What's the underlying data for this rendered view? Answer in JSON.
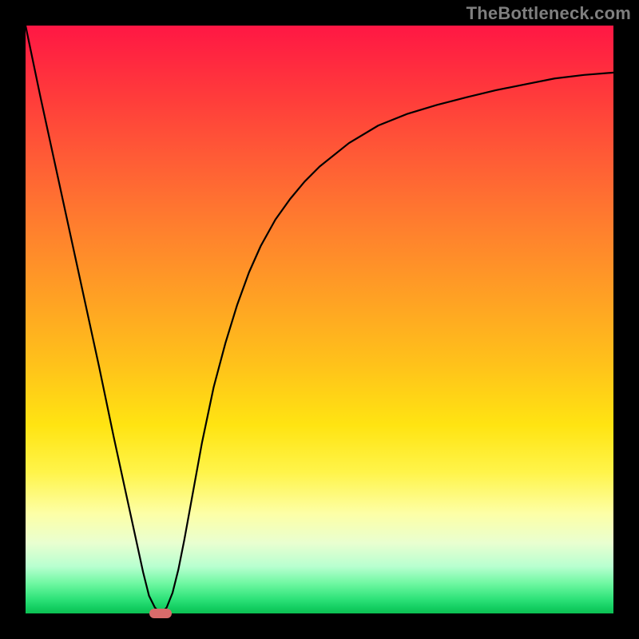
{
  "watermark": "TheBottleneck.com",
  "colors": {
    "frame": "#000000",
    "gradient_top": "#ff1744",
    "gradient_bottom": "#0dbf53",
    "curve": "#000000",
    "marker": "#d86b6b",
    "watermark_text": "#7f7f7f"
  },
  "chart_data": {
    "type": "line",
    "title": "",
    "xlabel": "",
    "ylabel": "",
    "xlim": [
      0,
      1
    ],
    "ylim": [
      0,
      1
    ],
    "x": [
      0.0,
      0.025,
      0.05,
      0.075,
      0.1,
      0.125,
      0.15,
      0.175,
      0.2,
      0.21,
      0.22,
      0.23,
      0.24,
      0.25,
      0.26,
      0.27,
      0.28,
      0.29,
      0.3,
      0.32,
      0.34,
      0.36,
      0.38,
      0.4,
      0.425,
      0.45,
      0.475,
      0.5,
      0.55,
      0.6,
      0.65,
      0.7,
      0.75,
      0.8,
      0.85,
      0.9,
      0.95,
      1.0
    ],
    "values": [
      1.0,
      0.88,
      0.765,
      0.65,
      0.535,
      0.42,
      0.3,
      0.185,
      0.07,
      0.03,
      0.01,
      0.0,
      0.01,
      0.035,
      0.075,
      0.125,
      0.18,
      0.235,
      0.29,
      0.385,
      0.46,
      0.525,
      0.58,
      0.625,
      0.67,
      0.705,
      0.735,
      0.76,
      0.8,
      0.83,
      0.85,
      0.865,
      0.878,
      0.89,
      0.9,
      0.91,
      0.916,
      0.92
    ],
    "marker": {
      "x": 0.23,
      "y": 0.0
    },
    "legend": [],
    "grid": false
  }
}
